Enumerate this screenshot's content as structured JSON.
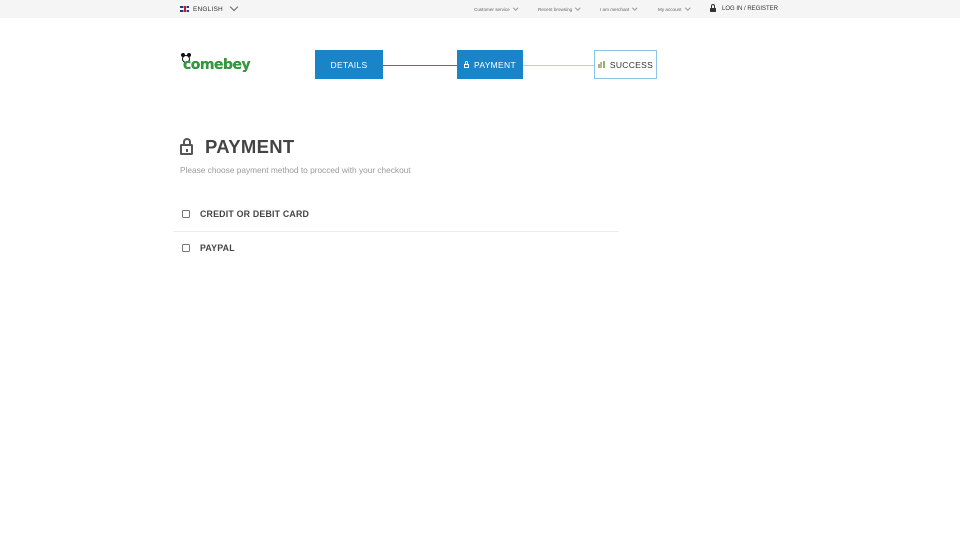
{
  "topbar": {
    "language": "ENGLISH",
    "nav": [
      {
        "label": "Customer service"
      },
      {
        "label": "Recent browsing"
      },
      {
        "label": "I am merchant"
      },
      {
        "label": "My account"
      }
    ],
    "login_label": "LOG IN / REGISTER"
  },
  "logo": {
    "text": "comebey"
  },
  "steps": [
    {
      "label": "DETAILS",
      "state": "done",
      "icon": null
    },
    {
      "label": "PAYMENT",
      "state": "current",
      "icon": "lock-icon"
    },
    {
      "label": "SUCCESS",
      "state": "pending",
      "icon": "bar-chart-icon"
    }
  ],
  "main": {
    "title": "PAYMENT",
    "subtitle": "Please choose payment method to  procced with your checkout",
    "options": [
      {
        "label": "CREDIT OR DEBIT CARD",
        "checked": false
      },
      {
        "label": "PAYPAL",
        "checked": false
      }
    ]
  },
  "colors": {
    "accent": "#1a84c8",
    "topbar_bg": "#f5f5f5",
    "logo_green": "#2e9d3b"
  }
}
